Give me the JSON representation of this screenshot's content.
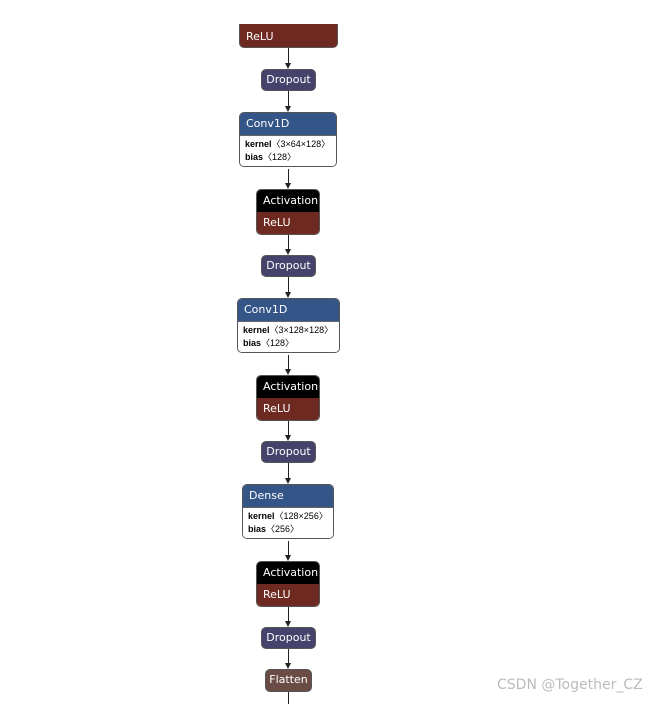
{
  "nodes": {
    "relu0": "ReLU",
    "dropout": "Dropout",
    "conv1": {
      "title": "Conv1D",
      "kernel_label": "kernel",
      "kernel": "〈3×64×128〉",
      "bias_label": "bias",
      "bias": "〈128〉"
    },
    "activation": "Activation",
    "relu": "ReLU",
    "conv2": {
      "title": "Conv1D",
      "kernel_label": "kernel",
      "kernel": "〈3×128×128〉",
      "bias_label": "bias",
      "bias": "〈128〉"
    },
    "dense": {
      "title": "Dense",
      "kernel_label": "kernel",
      "kernel": "〈128×256〉",
      "bias_label": "bias",
      "bias": "〈256〉"
    },
    "flatten": "Flatten"
  },
  "colors": {
    "relu": "#6e2920",
    "dropout": "#45426b",
    "layer": "#335588",
    "activation": "#000000",
    "flatten": "#6b4c45"
  },
  "watermark": "CSDN @Together_CZ"
}
